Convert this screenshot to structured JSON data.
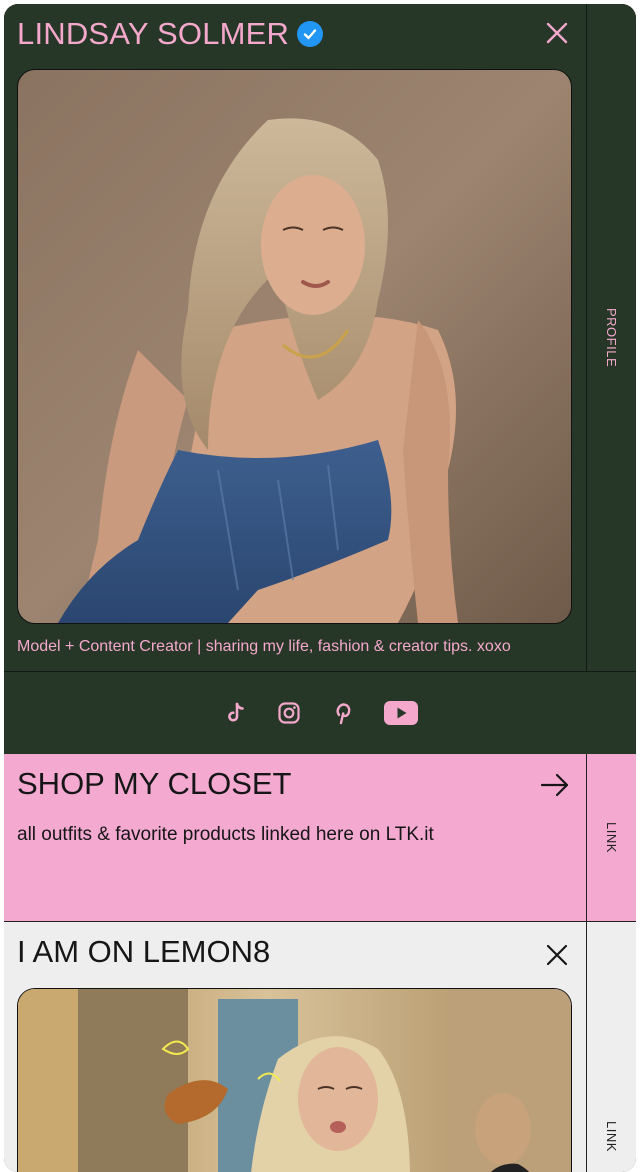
{
  "profile": {
    "name": "LINDSAY SOLMER",
    "bio": "Model + Content Creator | sharing my life, fashion & creator tips. xoxo",
    "tab_label": "PROFILE"
  },
  "social": [
    "tiktok-icon",
    "instagram-icon",
    "pinterest-icon",
    "youtube-icon"
  ],
  "shop": {
    "title": "SHOP MY CLOSET",
    "description": "all outfits & favorite products linked here on LTK.it",
    "tab_label": "LINK"
  },
  "lemon8": {
    "title": "I AM ON LEMON8",
    "tab_label": "LINK"
  },
  "colors": {
    "profile_bg": "#273727",
    "accent_pink": "#f4a8cc",
    "shop_bg": "#f4a9d1",
    "lemon_bg": "#eeeeee",
    "verified_blue": "#2196f3"
  }
}
